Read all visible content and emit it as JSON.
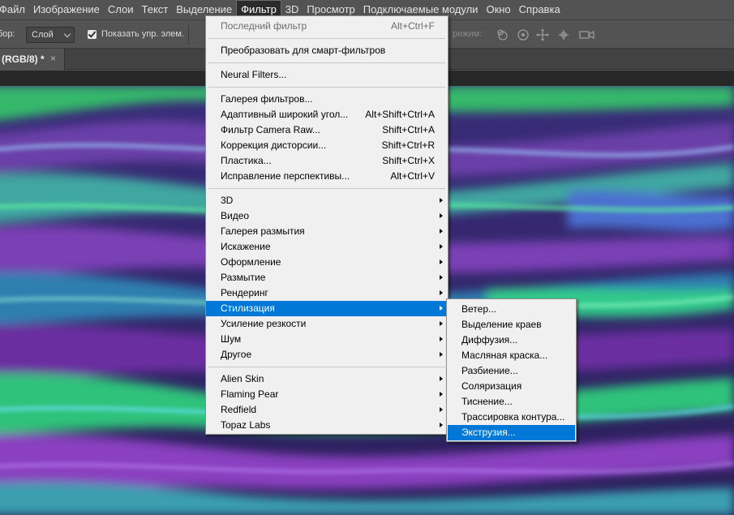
{
  "menubar": {
    "items": [
      "Файл",
      "Изображение",
      "Слои",
      "Текст",
      "Выделение",
      "Фильтр",
      "3D",
      "Просмотр",
      "Подключаемые модули",
      "Окно",
      "Справка"
    ],
    "active_index": 5
  },
  "optionsbar": {
    "sample_label": "бор:",
    "sample_value": "Слой",
    "show_transform_label": "Показать упр. элем.",
    "mode_3d_label": "режим:"
  },
  "tab": {
    "title": "(RGB/8) *",
    "close": "×"
  },
  "filter_menu": {
    "groups": [
      [
        {
          "label": "Последний фильтр",
          "shortcut": "Alt+Ctrl+F",
          "disabled": true
        }
      ],
      [
        {
          "label": "Преобразовать для смарт-фильтров"
        }
      ],
      [
        {
          "label": "Neural Filters..."
        }
      ],
      [
        {
          "label": "Галерея фильтров..."
        },
        {
          "label": "Адаптивный широкий угол...",
          "shortcut": "Alt+Shift+Ctrl+A"
        },
        {
          "label": "Фильтр Camera Raw...",
          "shortcut": "Shift+Ctrl+A"
        },
        {
          "label": "Коррекция дисторсии...",
          "shortcut": "Shift+Ctrl+R"
        },
        {
          "label": "Пластика...",
          "shortcut": "Shift+Ctrl+X"
        },
        {
          "label": "Исправление перспективы...",
          "shortcut": "Alt+Ctrl+V"
        }
      ],
      [
        {
          "label": "3D",
          "submenu": true
        },
        {
          "label": "Видео",
          "submenu": true
        },
        {
          "label": "Галерея размытия",
          "submenu": true
        },
        {
          "label": "Искажение",
          "submenu": true
        },
        {
          "label": "Оформление",
          "submenu": true
        },
        {
          "label": "Размытие",
          "submenu": true
        },
        {
          "label": "Рендеринг",
          "submenu": true
        },
        {
          "label": "Стилизация",
          "submenu": true,
          "highlighted": true
        },
        {
          "label": "Усиление резкости",
          "submenu": true
        },
        {
          "label": "Шум",
          "submenu": true
        },
        {
          "label": "Другое",
          "submenu": true
        }
      ],
      [
        {
          "label": "Alien Skin",
          "submenu": true
        },
        {
          "label": "Flaming Pear",
          "submenu": true
        },
        {
          "label": "Redfield",
          "submenu": true
        },
        {
          "label": "Topaz Labs",
          "submenu": true
        }
      ]
    ]
  },
  "stylize_submenu": {
    "items": [
      {
        "label": "Ветер..."
      },
      {
        "label": "Выделение краев"
      },
      {
        "label": "Диффузия..."
      },
      {
        "label": "Масляная краска..."
      },
      {
        "label": "Разбиение..."
      },
      {
        "label": "Соляризация"
      },
      {
        "label": "Тиснение..."
      },
      {
        "label": "Трассировка контура..."
      },
      {
        "label": "Экструзия...",
        "highlighted": true
      }
    ]
  },
  "colors": {
    "highlight": "#0078d7",
    "menu_bg": "#f0f0f0",
    "chrome_bg": "#535353"
  }
}
